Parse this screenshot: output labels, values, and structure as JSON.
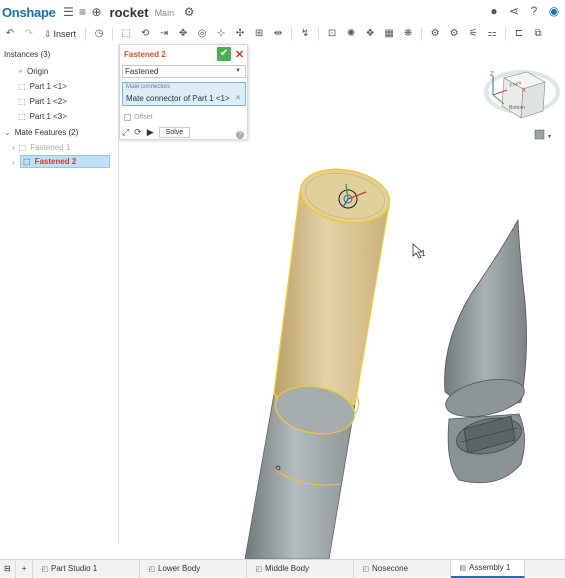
{
  "app": {
    "logo": "Onshape",
    "document_name": "rocket",
    "workspace": "Main"
  },
  "toolbar": {
    "insert_label": "Insert"
  },
  "instances": {
    "header": "Instances (3)",
    "items": [
      {
        "label": "Origin"
      },
      {
        "label": "Part 1 <1>"
      },
      {
        "label": "Part 1 <2>"
      },
      {
        "label": "Part 1 <3>"
      }
    ],
    "mate_features_header": "Mate Features (2)",
    "mates": [
      {
        "label": "Fastened 1",
        "selected": false
      },
      {
        "label": "Fastened 2",
        "selected": true
      }
    ]
  },
  "mate_dialog": {
    "title": "Fastened 2",
    "type_value": "Fastened",
    "connectors_label": "Mate connectors",
    "connector_value": "Mate connector of Part 1 <1>",
    "offset_label": "Offset",
    "solve_label": "Solve",
    "help": "?"
  },
  "view_cube": {
    "front": "Front",
    "bottom": "Bottom",
    "axis_z": "Z",
    "axis_x": "X"
  },
  "cursor_label": "1",
  "bottom_tabs": [
    {
      "label": "Part Studio 1",
      "active": false
    },
    {
      "label": "Lower Body",
      "active": false
    },
    {
      "label": "Middle Body",
      "active": false
    },
    {
      "label": "Nosecone",
      "active": false
    },
    {
      "label": "Assembly 1",
      "active": true
    }
  ],
  "colors": {
    "brand": "#1a6fb5",
    "accent_orange": "#d2552a",
    "confirm_green": "#4caf50",
    "selection_blue": "#bfe1f6",
    "body_tan": "#dcc596",
    "body_gray": "#9aa3a6",
    "highlight": "#f0c832"
  }
}
